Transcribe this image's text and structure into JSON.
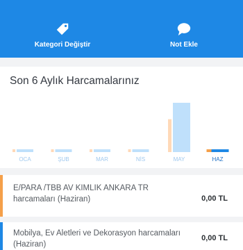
{
  "actions": {
    "change_category": {
      "label": "Kategori Değiştir",
      "icon": "tag-icon"
    },
    "add_note": {
      "label": "Not Ekle",
      "icon": "speech-bubble-icon"
    }
  },
  "spending_card": {
    "title": "Son 6 Aylık Harcamalarınız"
  },
  "chart_data": {
    "type": "bar",
    "categories": [
      "OCA",
      "ŞUB",
      "MAR",
      "NİS",
      "MAY",
      "HAZ"
    ],
    "series": [
      {
        "values": [
          1,
          1,
          1,
          1,
          12,
          1
        ]
      },
      {
        "values": [
          1,
          1,
          1,
          1,
          18,
          1
        ]
      }
    ],
    "selected_category": "HAZ",
    "colors": {
      "series_a": "#ffd9b8",
      "series_b": "#bfe0fb",
      "selected_a": "#f5a04a",
      "selected_b": "#1e88e5",
      "label": "#9fc8ee",
      "selected_label": "#1e6fc4"
    }
  },
  "transactions": [
    {
      "name": "E/PARA /TBB AV KIMLIK     ANKARA       TR harcamaları (Haziran)",
      "amount": "0,00 TL"
    },
    {
      "name": "Mobilya, Ev Aletleri ve Dekorasyon harcamaları (Haziran)",
      "amount": "0,00 TL"
    }
  ],
  "colors": {
    "header_bg": "#1e88e5",
    "row1_accent": "#f5a04a",
    "row2_accent": "#1e88e5"
  }
}
